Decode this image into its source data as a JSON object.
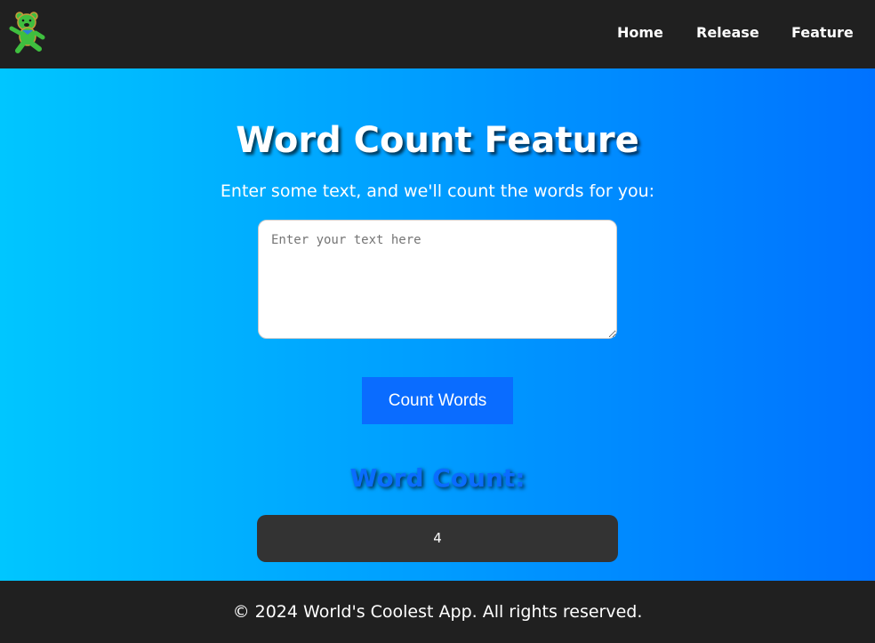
{
  "nav": {
    "logo": "dancing-bear-logo",
    "links": [
      "Home",
      "Release",
      "Feature"
    ]
  },
  "main": {
    "title": "Word Count Feature",
    "subtitle": "Enter some text, and we'll count the words for you:",
    "textarea_placeholder": "Enter your text here",
    "textarea_value": "",
    "button_label": "Count Words",
    "result_heading": "Word Count:",
    "result_value": "4"
  },
  "footer": {
    "text": "© 2024 World's Coolest App. All rights reserved."
  },
  "colors": {
    "nav_bg": "#202020",
    "gradient_start": "#00c6ff",
    "gradient_end": "#0072ff",
    "button": "#0a6cff",
    "result_box": "#333333"
  }
}
